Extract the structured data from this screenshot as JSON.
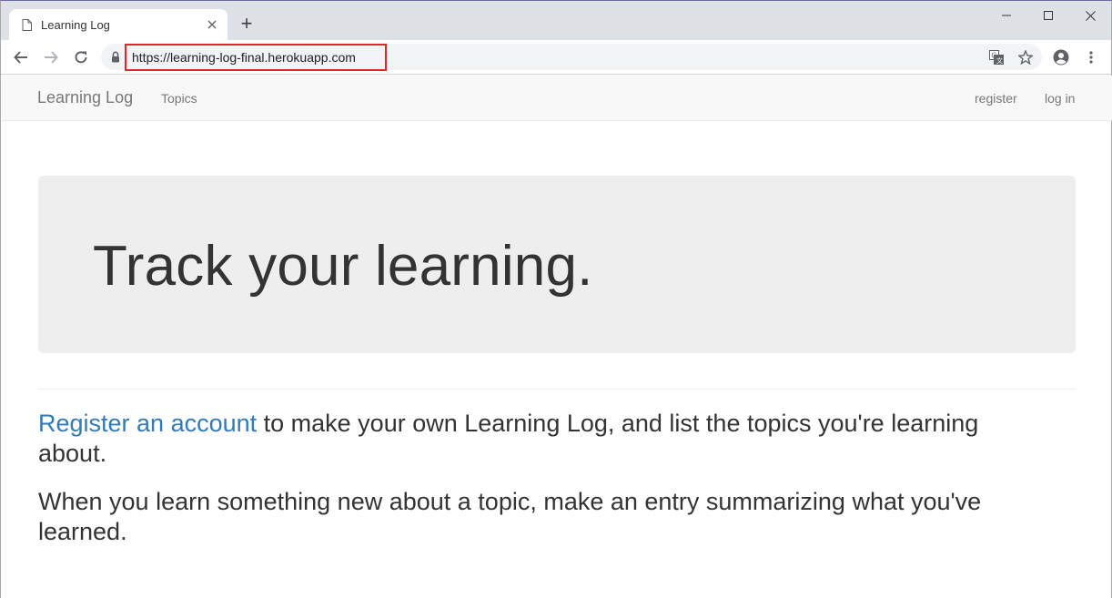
{
  "browser": {
    "tab_title": "Learning Log",
    "new_tab_label": "+",
    "url": "https://learning-log-final.herokuapp.com"
  },
  "navbar": {
    "brand": "Learning Log",
    "topics": "Topics",
    "register": "register",
    "login": "log in"
  },
  "jumbotron": {
    "title": "Track your learning."
  },
  "content": {
    "register_link": "Register an account",
    "intro_rest": " to make your own Learning Log, and list the topics you're learning about.",
    "entry_text": "When you learn something new about a topic, make an entry summarizing what you've learned."
  },
  "colors": {
    "link": "#337ab7",
    "highlight_border": "#e0262b",
    "jumbotron_bg": "#eeeeee",
    "navbar_bg": "#f8f8f8"
  }
}
